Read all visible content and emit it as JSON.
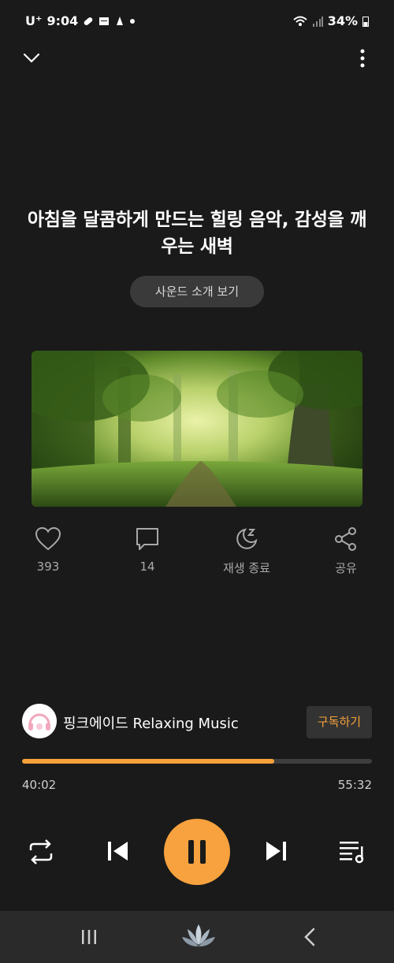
{
  "status_bar": {
    "carrier": "U⁺",
    "time": "9:04",
    "battery": "34%",
    "icons": [
      "pill-icon",
      "calendar-icon",
      "notification-icon",
      "wifi-icon",
      "signal-icon",
      "battery-icon"
    ]
  },
  "header": {
    "collapse_icon": "chevron-down-icon",
    "more_icon": "more-vertical-icon"
  },
  "track": {
    "title": "아침을 달콤하게 만드는 힐링 음악, 감성을 깨우는 새벽",
    "intro_button": "사운드 소개 보기"
  },
  "actions": [
    {
      "icon": "heart-icon",
      "label": "393"
    },
    {
      "icon": "comment-icon",
      "label": "14"
    },
    {
      "icon": "sleep-timer-icon",
      "label": "재생 종료"
    },
    {
      "icon": "share-icon",
      "label": "공유"
    }
  ],
  "channel": {
    "name": "핑크에이드 Relaxing Music",
    "subscribe": "구독하기"
  },
  "progress": {
    "current": "40:02",
    "total": "55:32",
    "fraction": 0.721
  },
  "controls": [
    "repeat-icon",
    "previous-icon",
    "pause-icon",
    "next-icon",
    "playlist-icon"
  ],
  "nav": [
    "recent-apps-icon",
    "home-lotus-icon",
    "back-icon"
  ],
  "colors": {
    "accent": "#f5a23a",
    "background": "#1a1a1a"
  }
}
